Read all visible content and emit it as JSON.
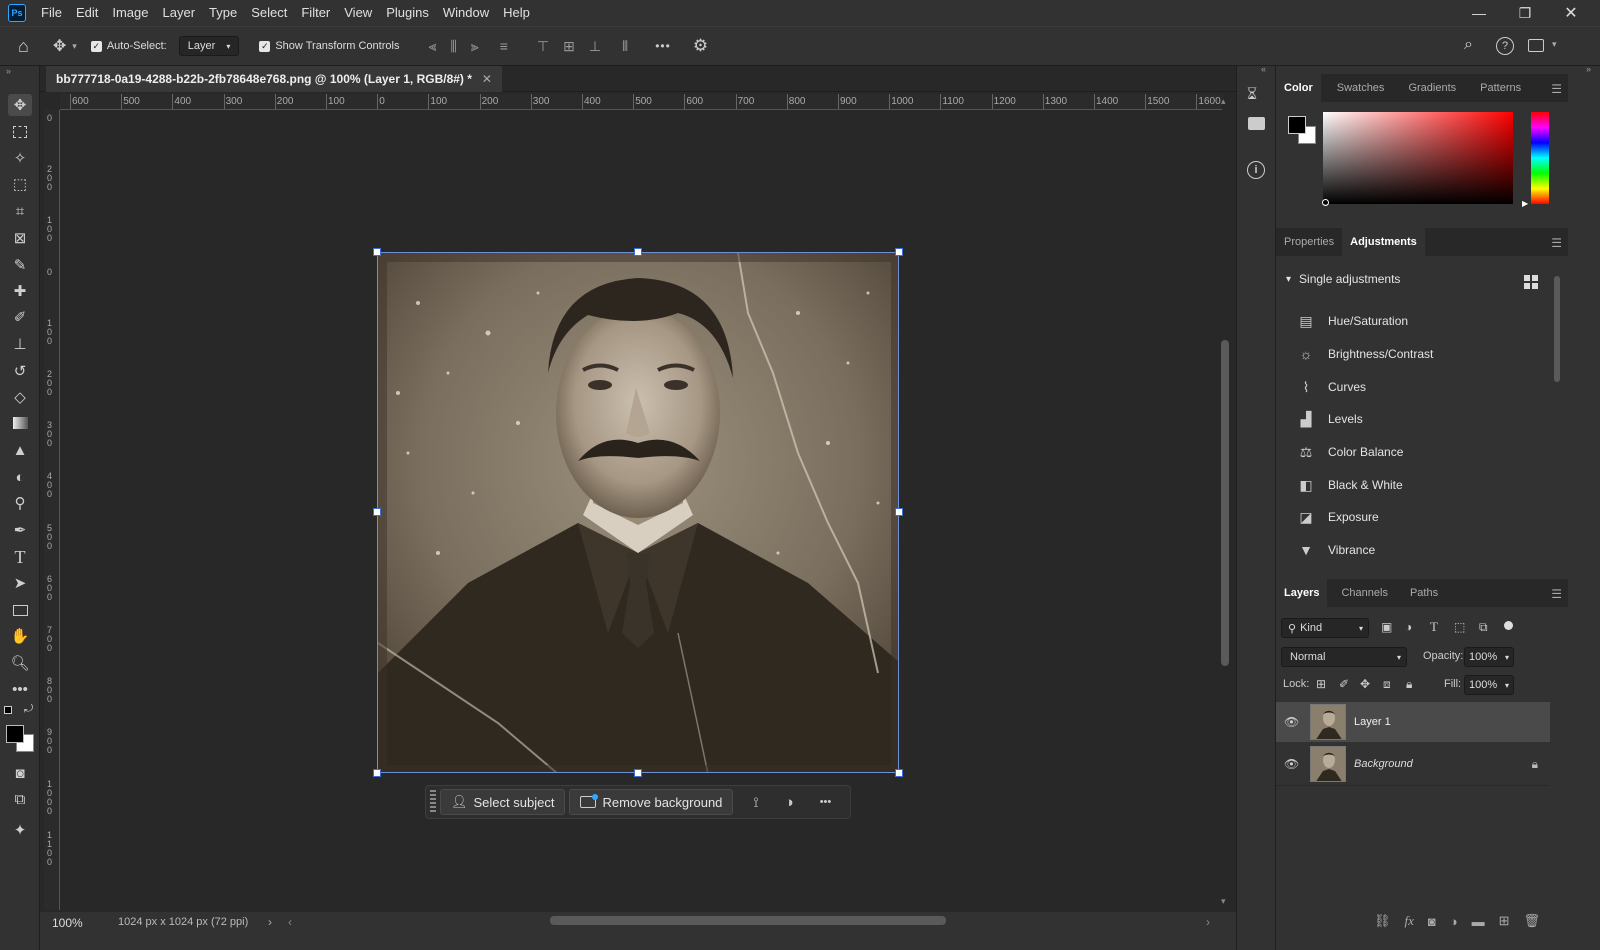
{
  "menubar": {
    "logo": "Ps",
    "items": [
      "File",
      "Edit",
      "Image",
      "Layer",
      "Type",
      "Select",
      "Filter",
      "View",
      "Plugins",
      "Window",
      "Help"
    ]
  },
  "optbar": {
    "auto_select_label": "Auto-Select:",
    "auto_select_target": "Layer",
    "transform_label": "Show Transform Controls",
    "more": "•••"
  },
  "document": {
    "tab_title": "bb777718-0a19-4288-b22b-2fb78648e768.png @ 100% (Layer 1, RGB/8#) *"
  },
  "ruler_top": [
    "600",
    "500",
    "400",
    "300",
    "200",
    "100",
    "0",
    "100",
    "200",
    "300",
    "400",
    "500",
    "600",
    "700",
    "800",
    "900",
    "1000",
    "1100",
    "1200",
    "1300",
    "1400",
    "1500",
    "1600"
  ],
  "ruler_left": [
    "0",
    "2 0 0",
    "1 0 0",
    "0",
    "1 0 0",
    "2 0 0",
    "3 0 0",
    "4 0 0",
    "5 0 0",
    "6 0 0",
    "7 0 0",
    "8 0 0",
    "9 0 0",
    "1 0 0 0",
    "1 1 0 0"
  ],
  "contextual_taskbar": {
    "select_subject": "Select subject",
    "remove_background": "Remove background",
    "more": "•••"
  },
  "statusbar": {
    "zoom": "100%",
    "doc_info": "1024 px x 1024 px (72 ppi)"
  },
  "color_panel": {
    "tabs": [
      "Color",
      "Swatches",
      "Gradients",
      "Patterns"
    ],
    "active_tab": "Color",
    "foreground": "#000000",
    "background": "#ffffff",
    "hue": "#ff0000"
  },
  "adjustments_panel": {
    "tabs": [
      "Properties",
      "Adjustments"
    ],
    "active_tab": "Adjustments",
    "section": "Single adjustments",
    "items": [
      {
        "label": "Hue/Saturation",
        "icon": "hue-saturation-icon"
      },
      {
        "label": "Brightness/Contrast",
        "icon": "brightness-contrast-icon"
      },
      {
        "label": "Curves",
        "icon": "curves-icon"
      },
      {
        "label": "Levels",
        "icon": "levels-icon"
      },
      {
        "label": "Color Balance",
        "icon": "color-balance-icon"
      },
      {
        "label": "Black & White",
        "icon": "black-white-icon"
      },
      {
        "label": "Exposure",
        "icon": "exposure-icon"
      },
      {
        "label": "Vibrance",
        "icon": "vibrance-icon"
      }
    ]
  },
  "layers_panel": {
    "tabs": [
      "Layers",
      "Channels",
      "Paths"
    ],
    "active_tab": "Layers",
    "filter_kind": "Kind",
    "blend_mode": "Normal",
    "opacity_label": "Opacity:",
    "opacity": "100%",
    "lock_label": "Lock:",
    "fill_label": "Fill:",
    "fill": "100%",
    "layers": [
      {
        "name": "Layer 1",
        "selected": true,
        "locked": false
      },
      {
        "name": "Background",
        "selected": false,
        "locked": true
      }
    ]
  }
}
